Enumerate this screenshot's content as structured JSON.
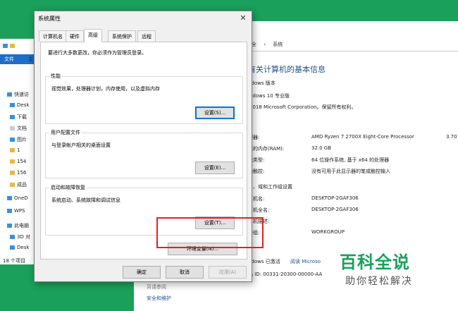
{
  "background_window": {
    "breadcrumb": [
      "安全",
      "系统"
    ],
    "heading": "有关计算机的基本信息",
    "edition_section": "ndows 版本",
    "edition": "ndows 10 专业版",
    "copyright": "2018 Microsoft Corporation。保留所有权利。",
    "rows": [
      {
        "label": "理器:",
        "value": "AMD Ryzen 7 2700X Eight-Core Processor",
        "extra": "3.70"
      },
      {
        "label": "装的内存(RAM):",
        "value": "32.0 GB"
      },
      {
        "label": "统类型:",
        "value": "64 位操作系统, 基于 x64 的处理器"
      },
      {
        "label": "和触控:",
        "value": "没有可用于此显示器的笔或触控输入"
      }
    ],
    "computer_section": "名、域和工作组设置",
    "computer_rows": [
      {
        "label": "算机名:",
        "value": "DESKTOP-2GAF306"
      },
      {
        "label": "算机全名:",
        "value": "DESKTOP-2GAF306"
      },
      {
        "label": "算机描述:",
        "value": ""
      },
      {
        "label": "作组:",
        "value": "WORKGROUP"
      }
    ],
    "activation": "ndows 已激活",
    "activation_link": "阅读 Microso",
    "product_id": "品 ID: 00331-20300-00000-AA",
    "see_also": "另请参阅",
    "security": "安全和维护"
  },
  "explorer": {
    "file_tab": "文件",
    "home_tab": "主",
    "status": "18 个项目",
    "items": [
      {
        "label": "快速访",
        "icon": "star-icon"
      },
      {
        "label": "Desk",
        "icon": "desktop-icon"
      },
      {
        "label": "下载",
        "icon": "download-icon"
      },
      {
        "label": "文档",
        "icon": "document-icon"
      },
      {
        "label": "图片",
        "icon": "picture-icon"
      },
      {
        "label": "1",
        "icon": "folder-icon"
      },
      {
        "label": "154",
        "icon": "folder-icon"
      },
      {
        "label": "156",
        "icon": "folder-icon"
      },
      {
        "label": "成品",
        "icon": "folder-icon"
      },
      {
        "label": "OneD",
        "icon": "cloud-icon"
      },
      {
        "label": "WPS",
        "icon": "cloud-icon"
      },
      {
        "label": "此电脑",
        "icon": "pc-icon"
      },
      {
        "label": "3D 对",
        "icon": "cube-icon"
      },
      {
        "label": "Desk",
        "icon": "desktop-icon"
      }
    ]
  },
  "dialog": {
    "title": "系统属性",
    "tabs": [
      "计算机名",
      "硬件",
      "高级",
      "系统保护",
      "远程"
    ],
    "active_tab": "高级",
    "admin_note": "要进行大多数更改，你必须作为管理员登录。",
    "groups": [
      {
        "title": "性能",
        "desc": "视觉效果，处理器计划，内存使用，以及虚拟内存",
        "button": "设置(S)..."
      },
      {
        "title": "用户配置文件",
        "desc": "与登录帐户相关的桌面设置",
        "button": "设置(E)..."
      },
      {
        "title": "启动和故障恢复",
        "desc": "系统启动、系统故障和调试信息",
        "button": "设置(T)..."
      }
    ],
    "env_button": "环境变量(N)...",
    "ok": "确定",
    "cancel": "取消",
    "apply": "应用(A)"
  },
  "watermark": {
    "big": "百科全说",
    "small": "助你轻松解决"
  },
  "colors": {
    "background": "#1aa05a",
    "highlight": "#e62020",
    "link": "#1f4e8c"
  }
}
